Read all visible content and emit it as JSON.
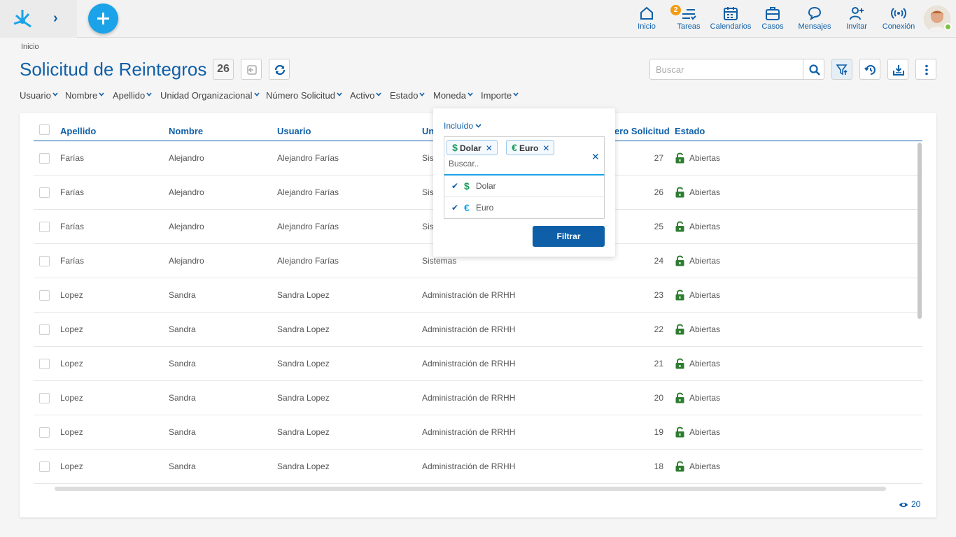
{
  "topnav": {
    "items": [
      {
        "label": "Inicio",
        "icon": "home-icon"
      },
      {
        "label": "Tareas",
        "icon": "tasks-icon",
        "badge": "2"
      },
      {
        "label": "Calendarios",
        "icon": "calendar-icon"
      },
      {
        "label": "Casos",
        "icon": "briefcase-icon"
      },
      {
        "label": "Mensajes",
        "icon": "chat-icon"
      },
      {
        "label": "Invitar",
        "icon": "invite-user-icon"
      },
      {
        "label": "Conexión",
        "icon": "connection-icon"
      }
    ]
  },
  "breadcrumb": "Inicio",
  "page": {
    "title": "Solicitud de Reintegros",
    "count": "26",
    "search_placeholder": "Buscar"
  },
  "filters": [
    "Usuario",
    "Nombre",
    "Apellido",
    "Unidad Organizacional",
    "Número Solicitud",
    "Activo",
    "Estado",
    "Moneda",
    "Importe"
  ],
  "columns": {
    "apellido": "Apellido",
    "nombre": "Nombre",
    "usuario": "Usuario",
    "unidad": "Un",
    "numero": "ero Solicitud",
    "estado": "Estado"
  },
  "rows": [
    {
      "apellido": "Farías",
      "nombre": "Alejandro",
      "usuario": "Alejandro Farías",
      "unidad": "Sis",
      "numero": "27",
      "estado": "Abiertas"
    },
    {
      "apellido": "Farías",
      "nombre": "Alejandro",
      "usuario": "Alejandro Farías",
      "unidad": "Sis",
      "numero": "26",
      "estado": "Abiertas"
    },
    {
      "apellido": "Farías",
      "nombre": "Alejandro",
      "usuario": "Alejandro Farías",
      "unidad": "Sis",
      "numero": "25",
      "estado": "Abiertas"
    },
    {
      "apellido": "Farías",
      "nombre": "Alejandro",
      "usuario": "Alejandro Farías",
      "unidad": "Sistemas",
      "numero": "24",
      "estado": "Abiertas"
    },
    {
      "apellido": "Lopez",
      "nombre": "Sandra",
      "usuario": "Sandra Lopez",
      "unidad": "Administración de RRHH",
      "numero": "23",
      "estado": "Abiertas"
    },
    {
      "apellido": "Lopez",
      "nombre": "Sandra",
      "usuario": "Sandra Lopez",
      "unidad": "Administración de RRHH",
      "numero": "22",
      "estado": "Abiertas"
    },
    {
      "apellido": "Lopez",
      "nombre": "Sandra",
      "usuario": "Sandra Lopez",
      "unidad": "Administración de RRHH",
      "numero": "21",
      "estado": "Abiertas"
    },
    {
      "apellido": "Lopez",
      "nombre": "Sandra",
      "usuario": "Sandra Lopez",
      "unidad": "Administración de RRHH",
      "numero": "20",
      "estado": "Abiertas"
    },
    {
      "apellido": "Lopez",
      "nombre": "Sandra",
      "usuario": "Sandra Lopez",
      "unidad": "Administración de RRHH",
      "numero": "19",
      "estado": "Abiertas"
    },
    {
      "apellido": "Lopez",
      "nombre": "Sandra",
      "usuario": "Sandra Lopez",
      "unidad": "Administración de RRHH",
      "numero": "18",
      "estado": "Abiertas"
    }
  ],
  "footer": {
    "view_count": "20"
  },
  "popover": {
    "mode_label": "Incluído",
    "tags": [
      {
        "symbol": "$",
        "label": "Dolar"
      },
      {
        "symbol": "€",
        "label": "Euro"
      }
    ],
    "search_placeholder": "Buscar..",
    "options": [
      {
        "symbol": "$",
        "label": "Dolar",
        "checked": true
      },
      {
        "symbol": "€",
        "label": "Euro",
        "checked": true
      }
    ],
    "button_label": "Filtrar"
  },
  "colors": {
    "brand_blue": "#0f5fa8",
    "accent_cyan": "#1aa3e8",
    "lock_green": "#2e7d32",
    "badge_orange": "#f39c12"
  }
}
